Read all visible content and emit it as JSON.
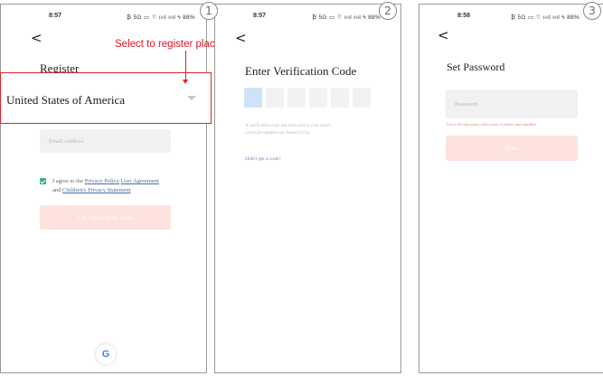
{
  "annotation": {
    "label": "Select to register place",
    "accent": "#e0141e"
  },
  "steps": [
    "1",
    "2",
    "3"
  ],
  "screen1": {
    "status_time": "8:57",
    "status_icons": "₿ 5G ▭ ⌔ ıııl ıııl ϟ 88%",
    "back": "<",
    "title": "Register",
    "country": "United States of America",
    "email_placeholder": "Email Address",
    "agree_prefix": "I agree to the",
    "privacy_policy": "Privacy Policy",
    "user_agreement": "User Agreement",
    "agree_and": "and",
    "children_privacy": "Children's Privacy Statement",
    "get_code_button": "Get Verification Code",
    "google": "G",
    "checkbox_color": "#3bb08f",
    "button_color": "#fde2de"
  },
  "screen2": {
    "status_time": "8:57",
    "status_icons": "₿ 5G ▭ ⌔ ıııl ıııl ϟ 88%",
    "back": "<",
    "title": "Enter Verification Code",
    "code_boxes": [
      "",
      "",
      "",
      "",
      "",
      ""
    ],
    "hint_line1": "A verification code has been sent to your email:",
    "hint_line2": "xxxxx@example.com Resend (55)s",
    "resend": "Didn't get a code?"
  },
  "screen3": {
    "status_time": "8:58",
    "status_icons": "₿ 5G ▭ ⌔ ıııl ıııl ϟ 88%",
    "back": "<",
    "title": "Set Password",
    "password_placeholder": "Password",
    "password_hint": "Use 6-20 characters with a mix of letters and numbers",
    "done_button": "Done"
  }
}
